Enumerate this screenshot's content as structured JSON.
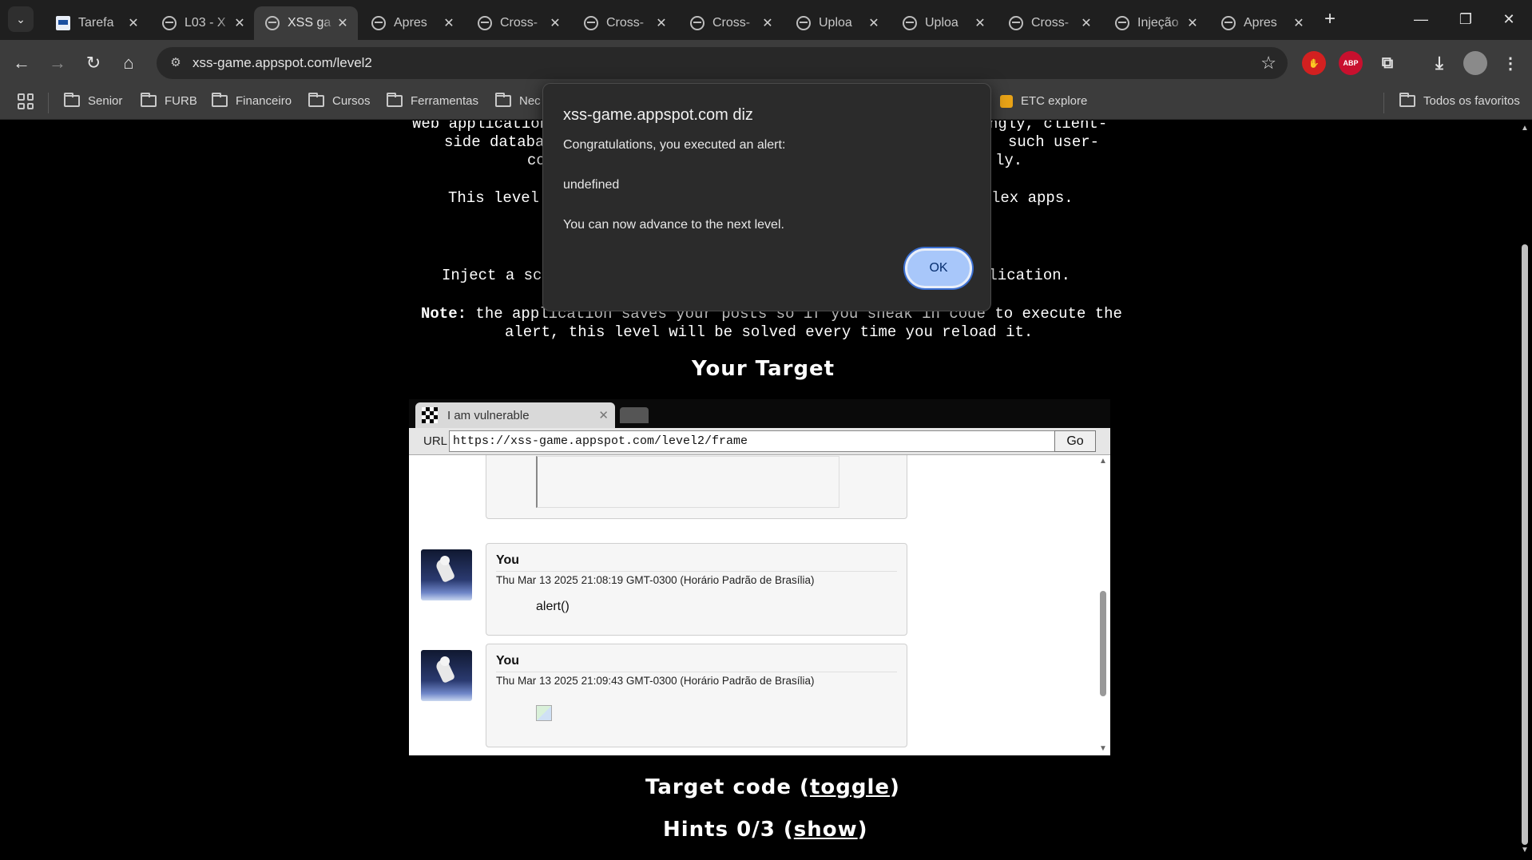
{
  "browser": {
    "tabs": [
      {
        "title": "Tarefa",
        "active": false
      },
      {
        "title": "L03 - X",
        "active": false
      },
      {
        "title": "XSS ga",
        "active": true
      },
      {
        "title": "Apres",
        "active": false
      },
      {
        "title": "Cross-",
        "active": false
      },
      {
        "title": "Cross-",
        "active": false
      },
      {
        "title": "Cross-",
        "active": false
      },
      {
        "title": "Uploa",
        "active": false
      },
      {
        "title": "Uploa",
        "active": false
      },
      {
        "title": "Cross-",
        "active": false
      },
      {
        "title": "Injeção",
        "active": false
      },
      {
        "title": "Apres",
        "active": false
      }
    ],
    "address": "xss-game.appspot.com/level2",
    "extensions": {
      "abp_label": "ABP"
    },
    "bookmarks": [
      {
        "label": "Senior"
      },
      {
        "label": "FURB"
      },
      {
        "label": "Financeiro"
      },
      {
        "label": "Cursos"
      },
      {
        "label": "Ferramentas"
      },
      {
        "label": "Nec"
      },
      {
        "label": "ETC explore"
      }
    ],
    "all_bookmarks": "Todos os favoritos"
  },
  "page": {
    "text_lines": [
      "Web application",
      "ngly, client-",
      "side databas",
      "such user-",
      "contr",
      "ly.",
      "This level",
      "lex apps.",
      "Inject a scr",
      "plication."
    ],
    "note_label": "Note:",
    "note_text_1": " the application saves your posts so if you sneak in code to execute the",
    "note_text_2": "alert, this level will be solved every time you reload it.",
    "your_target": "Your Target",
    "target_code_prefix": "Target code (",
    "target_code_link": "toggle",
    "target_code_suffix": ")",
    "hints_prefix": "Hints 0/3 (",
    "hints_link": "show",
    "hints_suffix": ")"
  },
  "frame": {
    "tab_title": "I am vulnerable",
    "url_label": "URL",
    "url": "https://xss-game.appspot.com/level2/frame",
    "go_label": "Go",
    "posts": [
      {
        "author": "You",
        "date": "Thu Mar 13 2025 21:08:19 GMT-0300 (Horário Padrão de Brasília)",
        "message": "alert()"
      },
      {
        "author": "You",
        "date": "Thu Mar 13 2025 21:09:43 GMT-0300 (Horário Padrão de Brasília)",
        "message": ""
      }
    ]
  },
  "dialog": {
    "title": "xss-game.appspot.com diz",
    "line1": "Congratulations, you executed an alert:",
    "line2": "undefined",
    "line3": "You can now advance to the next level.",
    "ok_label": "OK"
  },
  "colors": {
    "dialog_button": "#a8c7fa",
    "page_background": "#000000",
    "chrome_toolbar": "#3c3c3c"
  }
}
